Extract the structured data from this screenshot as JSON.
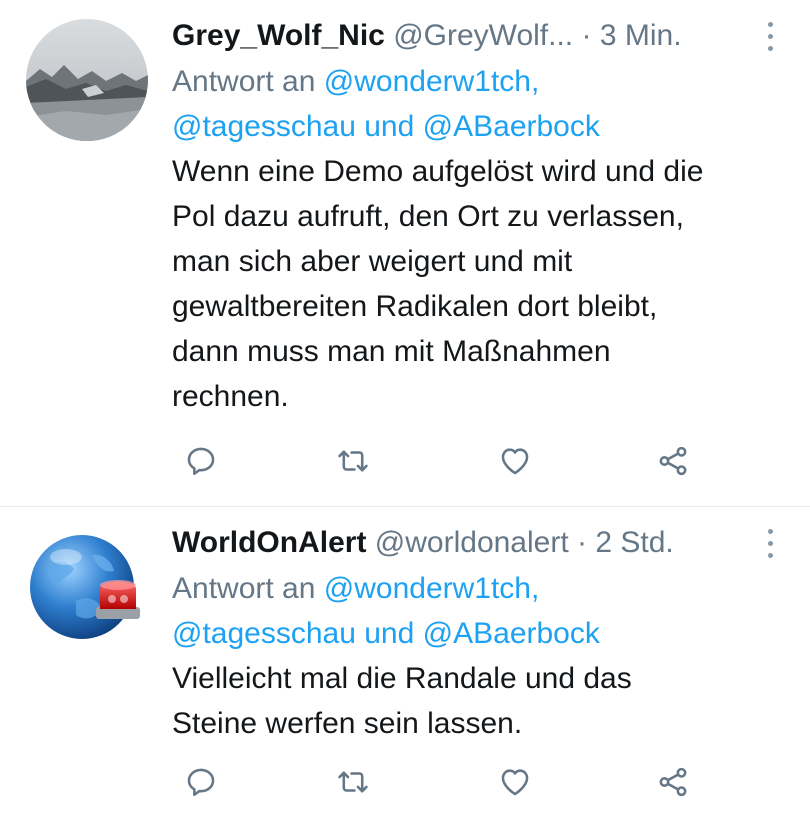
{
  "tweets": [
    {
      "name": "Grey_Wolf_Nic",
      "handle": "@GreyWolf...",
      "separator": "·",
      "time": "3 Min.",
      "reply_prefix": "Antwort an",
      "reply_mention_1": "@wonderw1tch,",
      "reply_mention_2": "@tagesschau",
      "reply_and": "und",
      "reply_mention_3": "@ABaerbock",
      "text_lines": [
        "Wenn eine Demo aufgelöst wird und die",
        "Pol dazu aufruft, den Ort zu verlassen,",
        "man sich aber weigert und mit",
        "gewaltbereiten Radikalen dort bleibt,",
        "dann muss man mit Maßnahmen",
        "rechnen."
      ],
      "avatar_icon": "landscape-photo"
    },
    {
      "name": "WorldOnAlert",
      "handle": "@worldonalert",
      "separator": "·",
      "time": "2 Std.",
      "reply_prefix": "Antwort an",
      "reply_mention_1": "@wonderw1tch,",
      "reply_mention_2": "@tagesschau",
      "reply_and": "und",
      "reply_mention_3": "@ABaerbock",
      "text_lines": [
        "Vielleicht mal die Randale und das",
        "Steine werfen sein lassen."
      ],
      "avatar_icon": "globe-alarm-light"
    }
  ],
  "icons": {
    "reply": "reply-icon",
    "retweet": "retweet-icon",
    "like": "heart-icon",
    "share": "share-icon",
    "more": "more-options-icon"
  },
  "colors": {
    "mention": "#1da1f2",
    "secondary_text": "#657786",
    "icon": "#657786"
  }
}
